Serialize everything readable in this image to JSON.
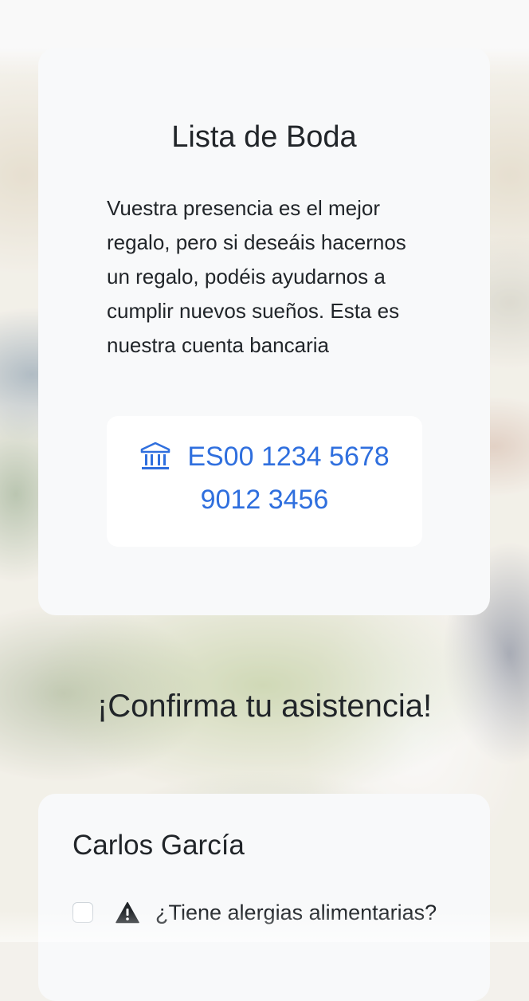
{
  "gift_registry": {
    "title": "Lista de Boda",
    "message": "Vuestra presencia es el mejor regalo, pero si deseáis hacernos un regalo, podéis ayudarnos a cumplir nuevos sueños. Esta es nuestra cuenta bancaria",
    "iban_part1": "ES00 1234 5678",
    "iban_part2": "9012 3456",
    "icon": "bank-icon"
  },
  "rsvp": {
    "title": "¡Confirma tu asistencia!",
    "guest": {
      "name": "Carlos García",
      "allergy_question": "¿Tiene alergias alimentarias?",
      "allergy_checked": false,
      "icon": "warning-icon"
    }
  },
  "colors": {
    "accent": "#2f6fde",
    "card_bg": "#f8f9fa",
    "text": "#212529"
  }
}
